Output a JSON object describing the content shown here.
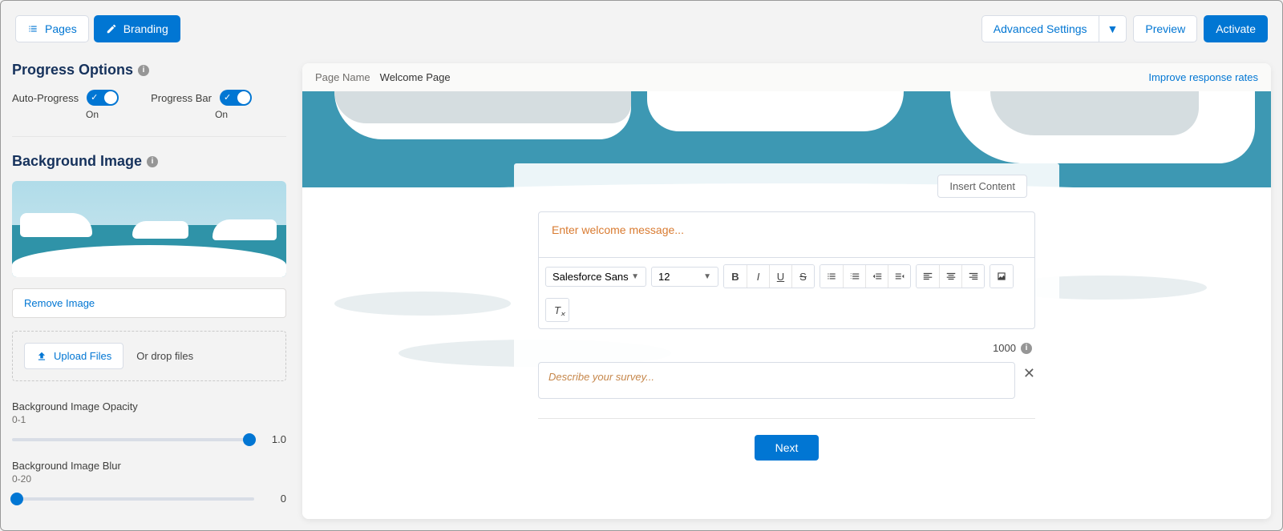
{
  "topbar": {
    "pages_label": "Pages",
    "branding_label": "Branding",
    "advanced_label": "Advanced Settings",
    "preview_label": "Preview",
    "activate_label": "Activate"
  },
  "progress": {
    "title": "Progress Options",
    "auto_label": "Auto-Progress",
    "auto_state": "On",
    "bar_label": "Progress Bar",
    "bar_state": "On"
  },
  "background": {
    "title": "Background Image",
    "remove_label": "Remove Image",
    "upload_label": "Upload Files",
    "drop_label": "Or drop files",
    "opacity_label": "Background Image Opacity",
    "opacity_range": "0-1",
    "opacity_value": "1.0",
    "blur_label": "Background Image Blur",
    "blur_range": "0-20",
    "blur_value": "0"
  },
  "preview": {
    "page_name_label": "Page Name",
    "page_name_value": "Welcome Page",
    "improve_link": "Improve response rates",
    "insert_label": "Insert Content",
    "welcome_placeholder": "Enter welcome message...",
    "font_family": "Salesforce Sans",
    "font_size": "12",
    "counter": "1000",
    "describe_placeholder": "Describe your survey...",
    "next_label": "Next"
  }
}
